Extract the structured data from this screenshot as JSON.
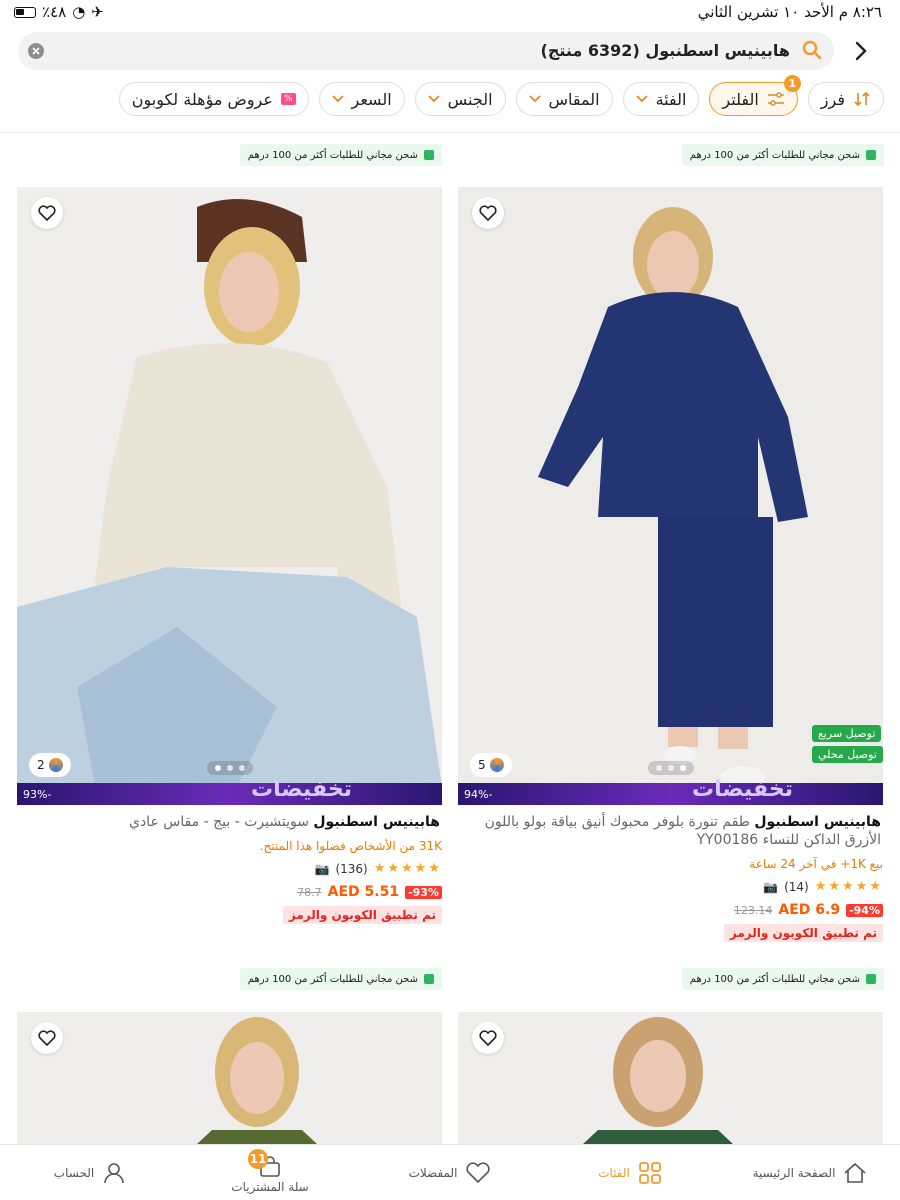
{
  "status": {
    "time": "٨:٢٦ م  الأحد ١٠ تشرين الثاني",
    "battery": "٪٤٨"
  },
  "search": {
    "query": "هابينيس اسطنبول (6392 منتج)"
  },
  "filters": [
    {
      "label": "فرز",
      "icon": "sort-icon"
    },
    {
      "label": "الفلتر",
      "icon": "filter-icon",
      "badge": "1",
      "active": true
    },
    {
      "label": "الفئة"
    },
    {
      "label": "المقاس"
    },
    {
      "label": "الجنس"
    },
    {
      "label": "السعر"
    },
    {
      "label": "عروض مؤهلة لكوبون",
      "tag": "%"
    }
  ],
  "shipping_text": "شحن مجاني للطلبات أكثر من 100 درهم",
  "products": [
    {
      "brand": "هابينيس اسطنبول",
      "name": "طقم تنورة بلوفر محبوك أنيق بياقة بولو باللون الأزرق الداكن للنساء YY00186",
      "colors": "5",
      "sale_pct": "94%-",
      "badges": [
        "توصيل سريع",
        "توصيل محلي"
      ],
      "sold": "بيع 1K+ في آخر 24 ساعة",
      "reviews": "(14)",
      "discount": "94%-",
      "price": "AED 6.9",
      "old_price": "123.14",
      "coupon": "تم تطبيق الكوبون والرمز"
    },
    {
      "brand": "هابينيس اسطنبول",
      "name": "سويتشيرت - بيج - مقاس عادي",
      "colors": "2",
      "sale_pct": "93%-",
      "sold": "31K من الأشخاص فضلوا هذا المنتج.",
      "reviews": "(136)",
      "discount": "93%-",
      "price": "AED 5.51",
      "old_price": "78.7",
      "coupon": "تم تطبيق الكوبون والرمز"
    }
  ],
  "sale_banner": "تخفيضات",
  "tabbar": [
    {
      "label": "الصفحة الرئيسية",
      "icon": "home-icon"
    },
    {
      "label": "الفئات",
      "icon": "categories-icon",
      "active": true
    },
    {
      "label": "المفضلات",
      "icon": "heart-icon"
    },
    {
      "label": "سلة المشتريات",
      "icon": "cart-icon",
      "count": "11"
    },
    {
      "label": "الحساب",
      "icon": "account-icon"
    }
  ],
  "colors": {
    "accent": "#f39a2a",
    "price": "#ff5a00",
    "shipping": "#2db55d",
    "coupon": "#e0251b"
  }
}
